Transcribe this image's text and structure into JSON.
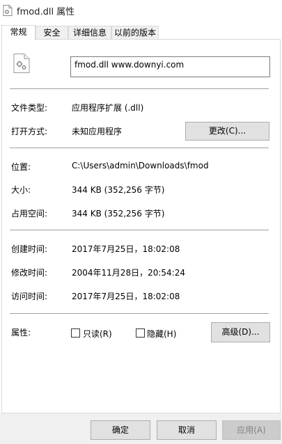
{
  "window": {
    "title": "fmod.dll 属性",
    "icon": "dll-file-icon"
  },
  "tabs": [
    {
      "label": "常规",
      "active": true
    },
    {
      "label": "安全",
      "active": false
    },
    {
      "label": "详细信息",
      "active": false
    },
    {
      "label": "以前的版本",
      "active": false
    }
  ],
  "general": {
    "file_name": "fmod.dll     www.downyi.com",
    "file_type_label": "文件类型:",
    "file_type_value": "应用程序扩展 (.dll)",
    "open_with_label": "打开方式:",
    "open_with_value": "未知应用程序",
    "change_button": "更改(C)...",
    "location_label": "位置:",
    "location_value": "C:\\Users\\admin\\Downloads\\fmod",
    "size_label": "大小:",
    "size_value": "344 KB (352,256 字节)",
    "size_on_disk_label": "占用空间:",
    "size_on_disk_value": "344 KB (352,256 字节)",
    "created_label": "创建时间:",
    "created_value": "2017年7月25日，18:02:08",
    "modified_label": "修改时间:",
    "modified_value": "2004年11月28日，20:54:24",
    "accessed_label": "访问时间:",
    "accessed_value": "2017年7月25日，18:02:08",
    "attributes_label": "属性:",
    "readonly_label": "只读(R)",
    "hidden_label": "隐藏(H)",
    "advanced_button": "高级(D)..."
  },
  "footer": {
    "ok_button": "确定",
    "cancel_button": "取消",
    "apply_button": "应用(A)"
  }
}
